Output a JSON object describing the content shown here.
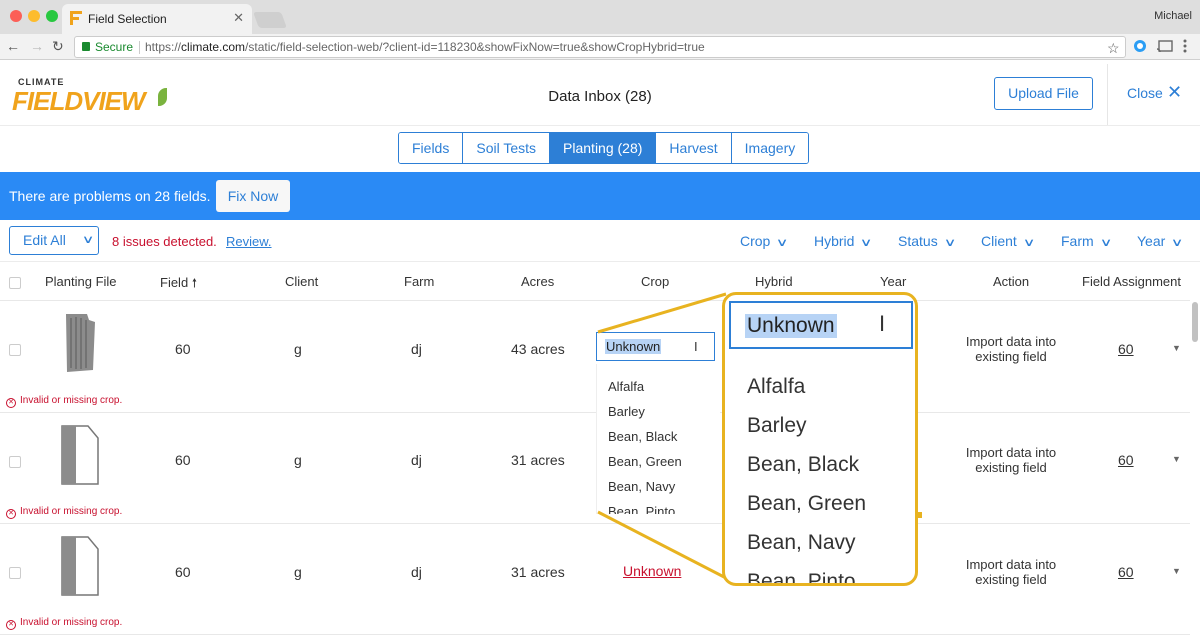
{
  "browser": {
    "tab_title": "Field Selection",
    "tab_close": "✕",
    "user_name": "Michael",
    "secure_label": "Secure",
    "url_scheme": "https://",
    "url_host": "climate.com",
    "url_path": "/static/field-selection-web/?client-id=118230&showFixNow=true&showCropHybrid=true",
    "nav_back": "←",
    "nav_forward": "→",
    "nav_reload": "↻",
    "star": "☆"
  },
  "header": {
    "logo_small": "CLIMATE",
    "logo_main": "FIELDVIEW",
    "title": "Data Inbox (28)",
    "upload_label": "Upload File",
    "close_label": "Close",
    "close_icon": "✕"
  },
  "tabs": [
    {
      "label": "Fields",
      "active": false
    },
    {
      "label": "Soil Tests",
      "active": false
    },
    {
      "label": "Planting (28)",
      "active": true
    },
    {
      "label": "Harvest",
      "active": false
    },
    {
      "label": "Imagery",
      "active": false
    }
  ],
  "banner": {
    "message": "There are problems on 28 fields.",
    "fix_label": "Fix Now",
    "color": "#2a8af5"
  },
  "filters": {
    "edit_all": "Edit All",
    "issues_text": "8 issues detected.",
    "review_link": "Review.",
    "items": [
      "Crop",
      "Hybrid",
      "Status",
      "Client",
      "Farm",
      "Year"
    ]
  },
  "table": {
    "columns": [
      "Planting File",
      "Field",
      "Client",
      "Farm",
      "Acres",
      "Crop",
      "Hybrid",
      "Year",
      "Action",
      "Field Assignment"
    ],
    "sort_icon": "🠕",
    "rows": [
      {
        "field": "60",
        "client": "g",
        "farm": "dj",
        "acres": "43 acres",
        "crop": "Unknown",
        "action": "Import data into existing field",
        "assignment": "60",
        "error": "Invalid or missing crop."
      },
      {
        "field": "60",
        "client": "g",
        "farm": "dj",
        "acres": "31 acres",
        "crop": "",
        "action": "Import data into existing field",
        "assignment": "60",
        "error": "Invalid or missing crop."
      },
      {
        "field": "60",
        "client": "g",
        "farm": "dj",
        "acres": "31 acres",
        "crop": "Unknown",
        "action": "Import data into existing field",
        "assignment": "60",
        "error": "Invalid or missing crop."
      }
    ]
  },
  "crop_dropdown": {
    "input_value": "Unknown",
    "options": [
      "Alfalfa",
      "Barley",
      "Bean, Black",
      "Bean, Green",
      "Bean, Navy",
      "Bean, Pinto"
    ]
  },
  "colors": {
    "accent": "#2d7fd6",
    "error": "#c8102e",
    "highlight": "#e8b320"
  }
}
